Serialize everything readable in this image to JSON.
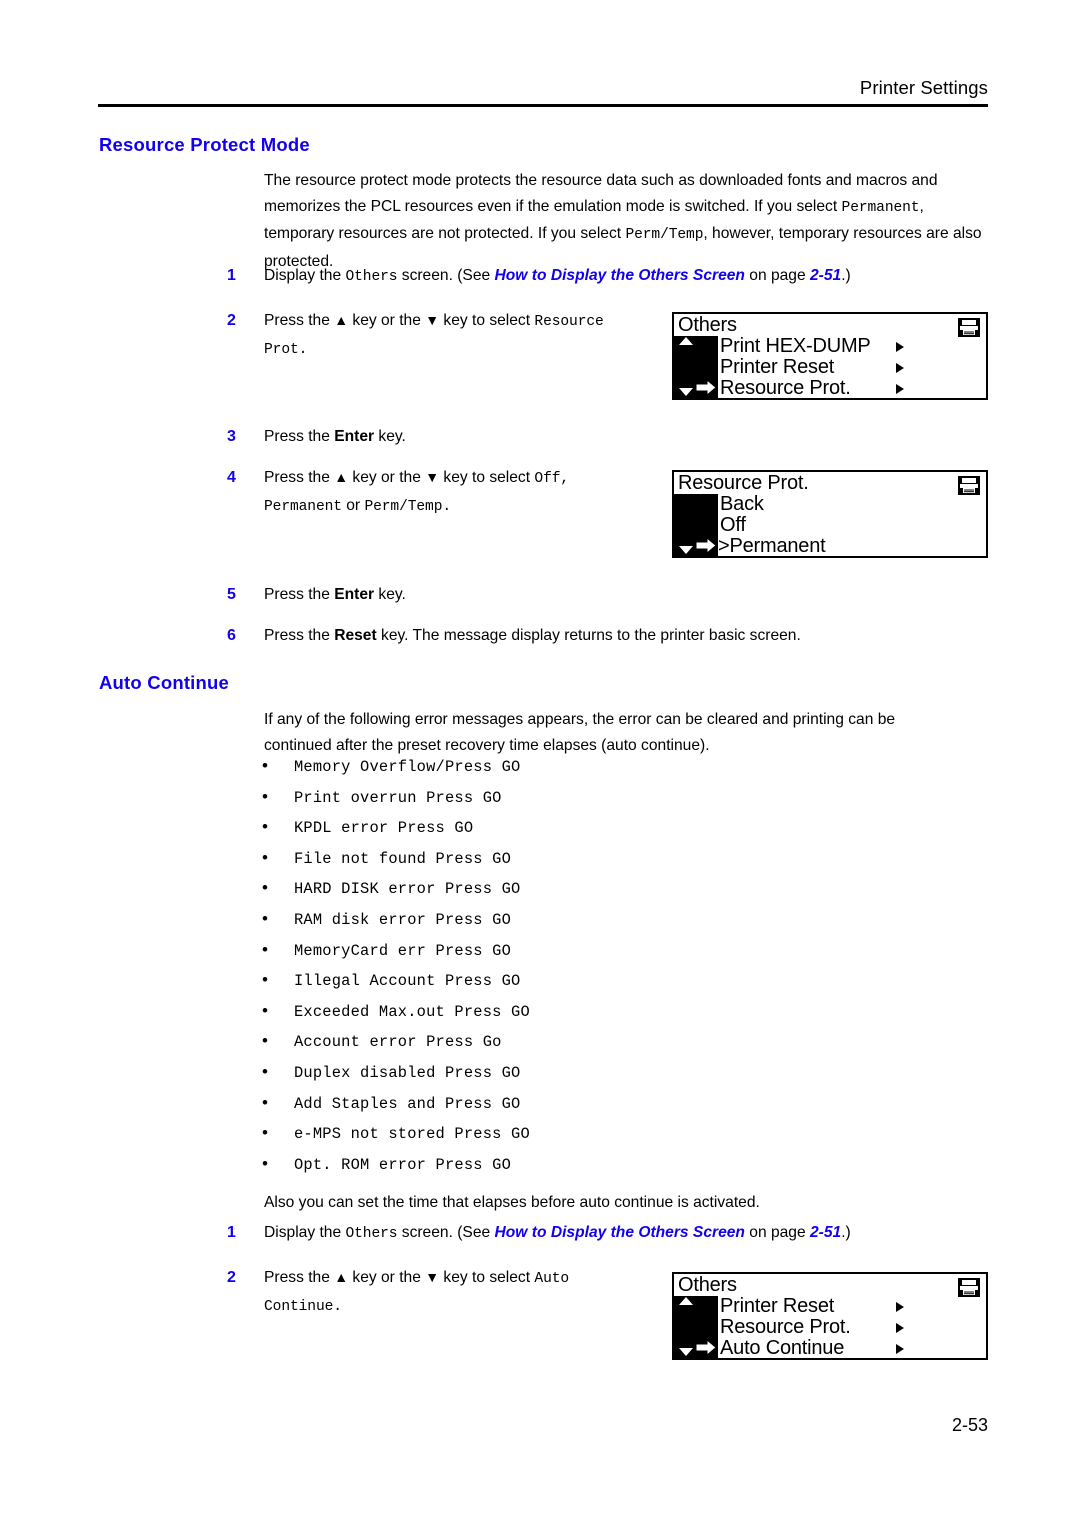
{
  "header": {
    "title": "Printer Settings"
  },
  "sections": {
    "resource_protect": {
      "heading": "Resource Protect Mode",
      "paragraph": {
        "part1": "The resource protect mode protects the resource data such as downloaded fonts and macros and memorizes the PCL resources even if the emulation mode is switched. If you select ",
        "mono1": "Permanent",
        "part2": ", temporary resources are not protected. If you select ",
        "mono2": "Perm/Temp",
        "part3": ", however, temporary resources are also protected."
      },
      "steps": [
        {
          "num": "1",
          "pre": "Display the ",
          "mono": "Others",
          "mid": " screen. (See ",
          "link": "How to Display the Others Screen",
          "mid2": " on page ",
          "page_ref": "2-51",
          "post": ".)"
        },
        {
          "num": "2",
          "pre": "Press the ",
          "up": "▲",
          "mid": " key or the ",
          "down": "▼",
          "mid2": " key to select ",
          "mono": "Resource Prot."
        },
        {
          "num": "3",
          "pre": "Press the ",
          "bold": "Enter",
          "post": " key."
        },
        {
          "num": "4",
          "pre": "Press the ",
          "up": "▲",
          "mid": " key or the ",
          "down": "▼",
          "mid2": " key to select ",
          "mono": "Off,",
          "mono2": "Permanent",
          "joiner": " or ",
          "mono3": "Perm/Temp."
        },
        {
          "num": "5",
          "pre": "Press the ",
          "bold": "Enter",
          "post": " key."
        },
        {
          "num": "6",
          "pre": "Press the ",
          "bold": "Reset",
          "post": " key. The message display returns to the printer basic screen."
        }
      ]
    },
    "auto_continue": {
      "heading": "Auto Continue",
      "paragraph": "If any of the following error messages appears, the error can be cleared and printing can be continued after the preset recovery time elapses (auto continue).",
      "error_messages": [
        "Memory Overflow/Press GO",
        "Print overrun Press GO",
        "KPDL error Press GO",
        "File not found Press GO",
        "HARD DISK error Press GO",
        "RAM disk error Press GO",
        "MemoryCard err Press GO",
        "Illegal Account Press GO",
        "Exceeded Max.out Press GO",
        "Account error Press Go",
        "Duplex disabled Press GO",
        "Add Staples and Press GO",
        "e-MPS not stored Press GO",
        "Opt. ROM error Press GO"
      ],
      "also_text": "Also you can set the time that elapses before auto continue is activated.",
      "steps": [
        {
          "num": "1",
          "pre": "Display the ",
          "mono": "Others",
          "mid": " screen. (See ",
          "link": "How to Display the Others Screen",
          "mid2": " on page ",
          "page_ref": "2-51",
          "post": ".)"
        },
        {
          "num": "2",
          "pre": "Press the ",
          "up": "▲",
          "mid": " key or the ",
          "down": "▼",
          "mid2": " key to select ",
          "mono": "Auto Continue."
        }
      ]
    }
  },
  "lcd_panels": [
    {
      "id": "others-resource-prot",
      "title": "Others",
      "has_up_arrow": true,
      "has_down_arrow": true,
      "rows": [
        {
          "label": "Print HEX-DUMP",
          "arrow": true,
          "selected": false
        },
        {
          "label": "Printer Reset",
          "arrow": true,
          "selected": false
        },
        {
          "label": "Resource Prot.",
          "arrow": true,
          "selected": true
        }
      ]
    },
    {
      "id": "resource-prot-permanent",
      "title": "Resource Prot.",
      "has_up_arrow": false,
      "has_down_arrow": true,
      "rows": [
        {
          "label": "Back",
          "arrow": false,
          "selected": false
        },
        {
          "label": "Off",
          "arrow": false,
          "selected": false
        },
        {
          "label": ">Permanent",
          "arrow": false,
          "selected": true
        }
      ]
    },
    {
      "id": "others-auto-continue",
      "title": "Others",
      "has_up_arrow": true,
      "has_down_arrow": true,
      "rows": [
        {
          "label": "Printer Reset",
          "arrow": true,
          "selected": false
        },
        {
          "label": "Resource Prot.",
          "arrow": true,
          "selected": false
        },
        {
          "label": "Auto Continue",
          "arrow": true,
          "selected": true
        }
      ]
    }
  ],
  "footer": {
    "page_number": "2-53"
  },
  "colors": {
    "heading_blue": "#1200ee",
    "text_black": "#000000",
    "page_background": "#ffffff"
  }
}
